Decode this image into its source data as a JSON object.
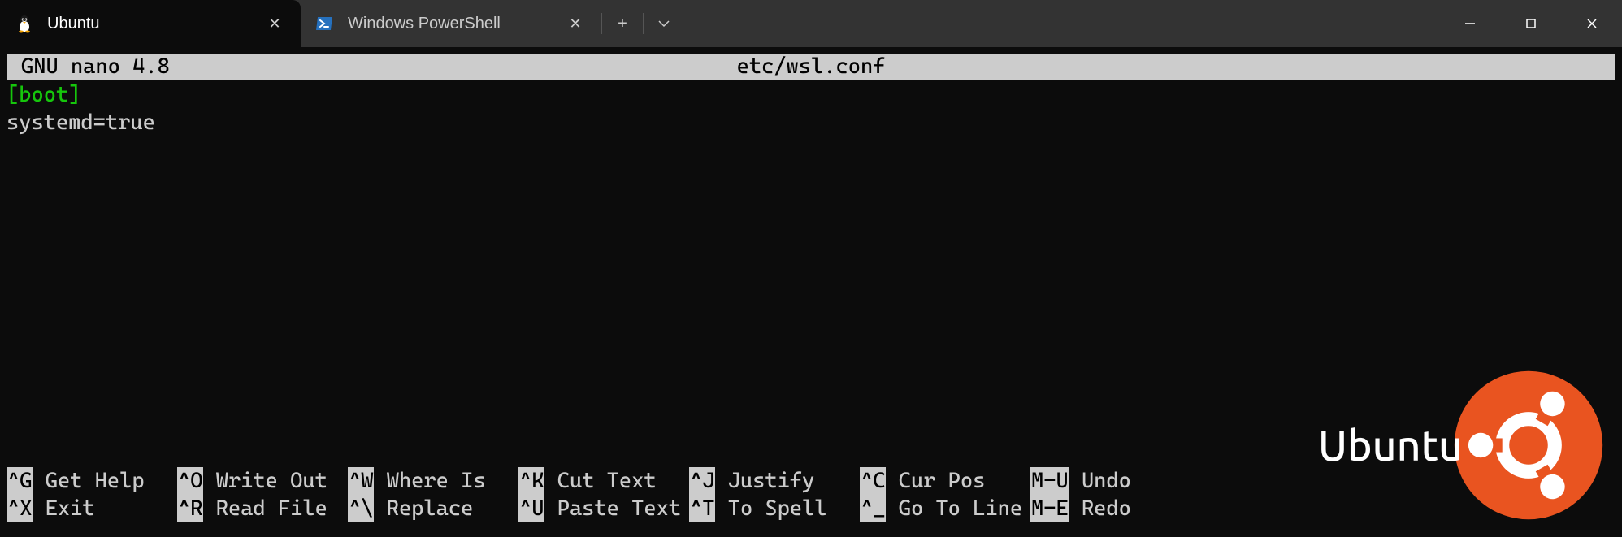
{
  "titlebar": {
    "tabs": [
      {
        "label": "Ubuntu",
        "active": true
      },
      {
        "label": "Windows PowerShell",
        "active": false
      }
    ]
  },
  "nano": {
    "app_title": "GNU nano 4.8",
    "filename": "etc/wsl.conf",
    "content": {
      "section": "[boot]",
      "line1": "systemd=true"
    },
    "shortcuts": {
      "row1": [
        {
          "key": "^G",
          "label": "Get Help"
        },
        {
          "key": "^O",
          "label": "Write Out"
        },
        {
          "key": "^W",
          "label": "Where Is"
        },
        {
          "key": "^K",
          "label": "Cut Text"
        },
        {
          "key": "^J",
          "label": "Justify"
        },
        {
          "key": "^C",
          "label": "Cur Pos"
        },
        {
          "key": "M-U",
          "label": "Undo"
        }
      ],
      "row2": [
        {
          "key": "^X",
          "label": "Exit"
        },
        {
          "key": "^R",
          "label": "Read File"
        },
        {
          "key": "^\\",
          "label": "Replace"
        },
        {
          "key": "^U",
          "label": "Paste Text"
        },
        {
          "key": "^T",
          "label": "To Spell"
        },
        {
          "key": "^_",
          "label": "Go To Line"
        },
        {
          "key": "M-E",
          "label": "Redo"
        }
      ]
    }
  },
  "watermark": {
    "text": "Ubuntu"
  }
}
